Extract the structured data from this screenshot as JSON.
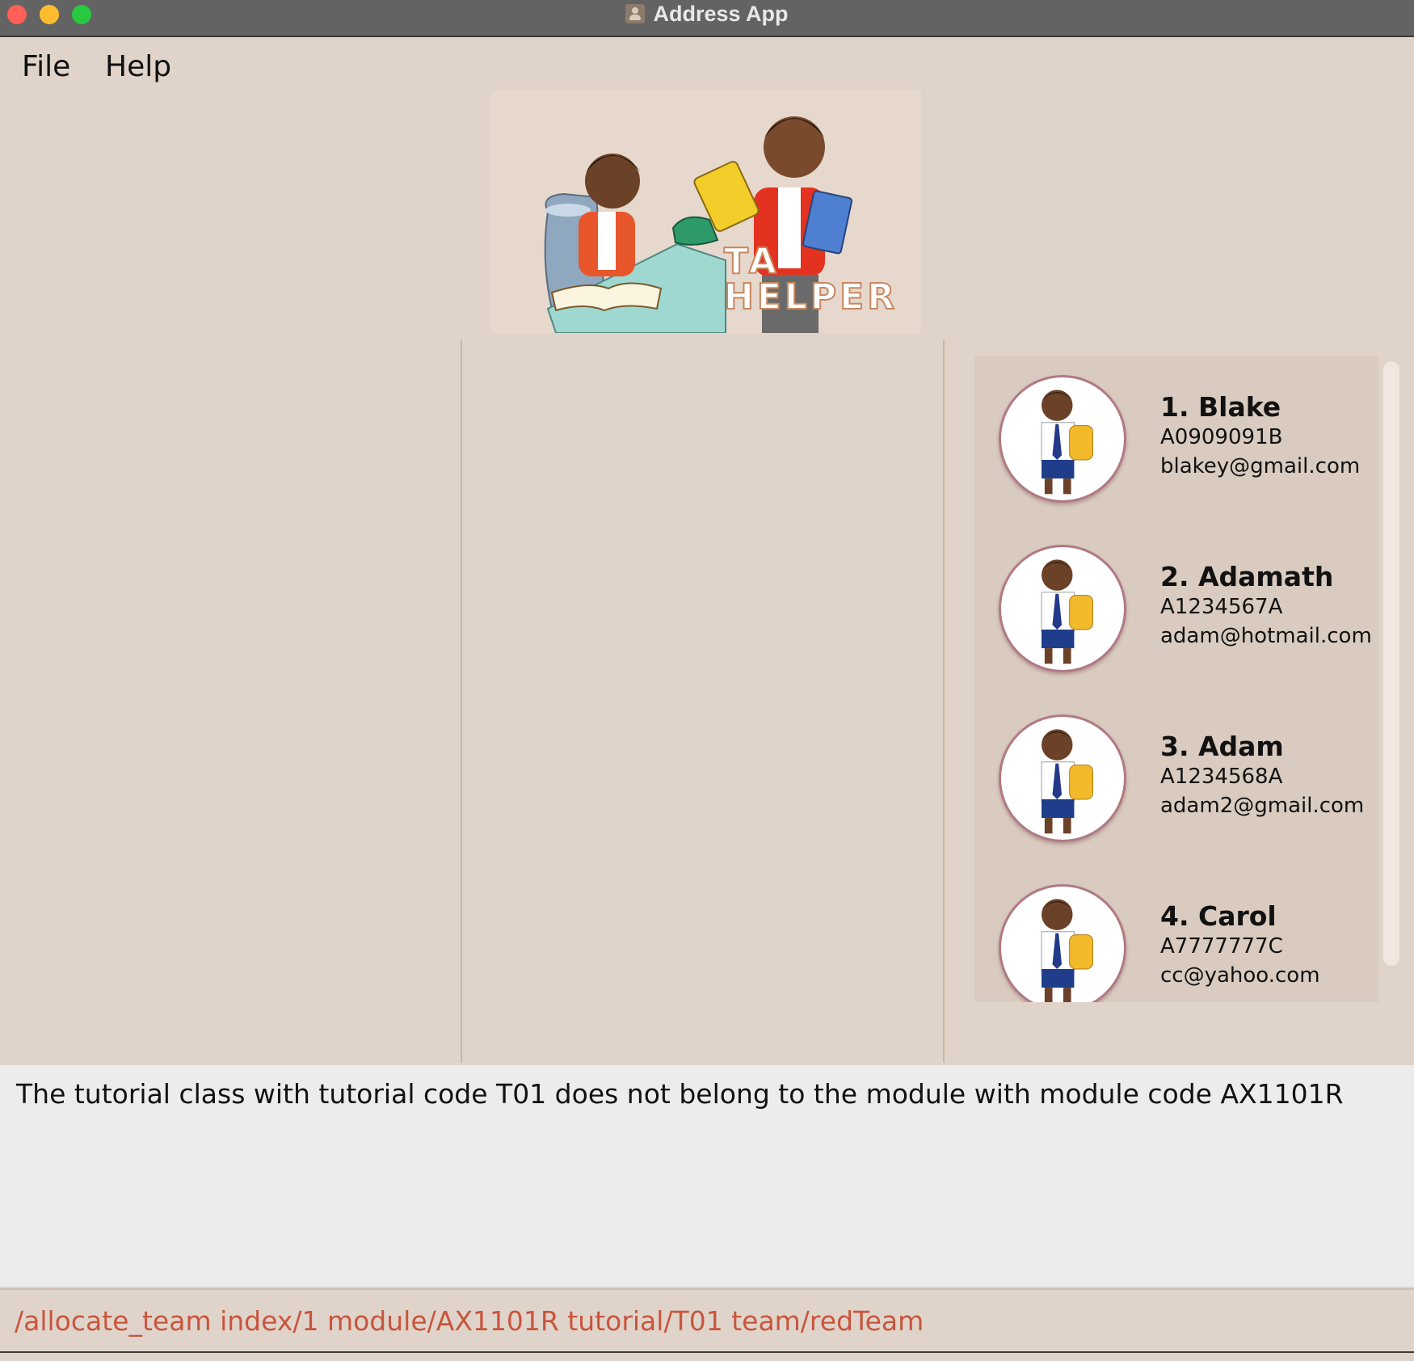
{
  "window": {
    "title": "Address App"
  },
  "menu": {
    "file": "File",
    "help": "Help"
  },
  "logo": {
    "line1": "TA",
    "line2": "HELPER"
  },
  "students": [
    {
      "index_name": "1.  Blake",
      "id": "A0909091B",
      "email": "blakey@gmail.com"
    },
    {
      "index_name": "2.  Adamath",
      "id": "A1234567A",
      "email": "adam@hotmail.com"
    },
    {
      "index_name": "3.  Adam",
      "id": "A1234568A",
      "email": "adam2@gmail.com"
    },
    {
      "index_name": "4.  Carol",
      "id": "A7777777C",
      "email": "cc@yahoo.com"
    }
  ],
  "result": {
    "message": "The tutorial class with tutorial code T01 does not belong to the module with module code AX1101R"
  },
  "command": {
    "value": "/allocate_team index/1 module/AX1101R tutorial/T01 team/redTeam"
  },
  "colors": {
    "background": "#e0d4ca",
    "command_text": "#c8553d",
    "titlebar": "#636363"
  }
}
